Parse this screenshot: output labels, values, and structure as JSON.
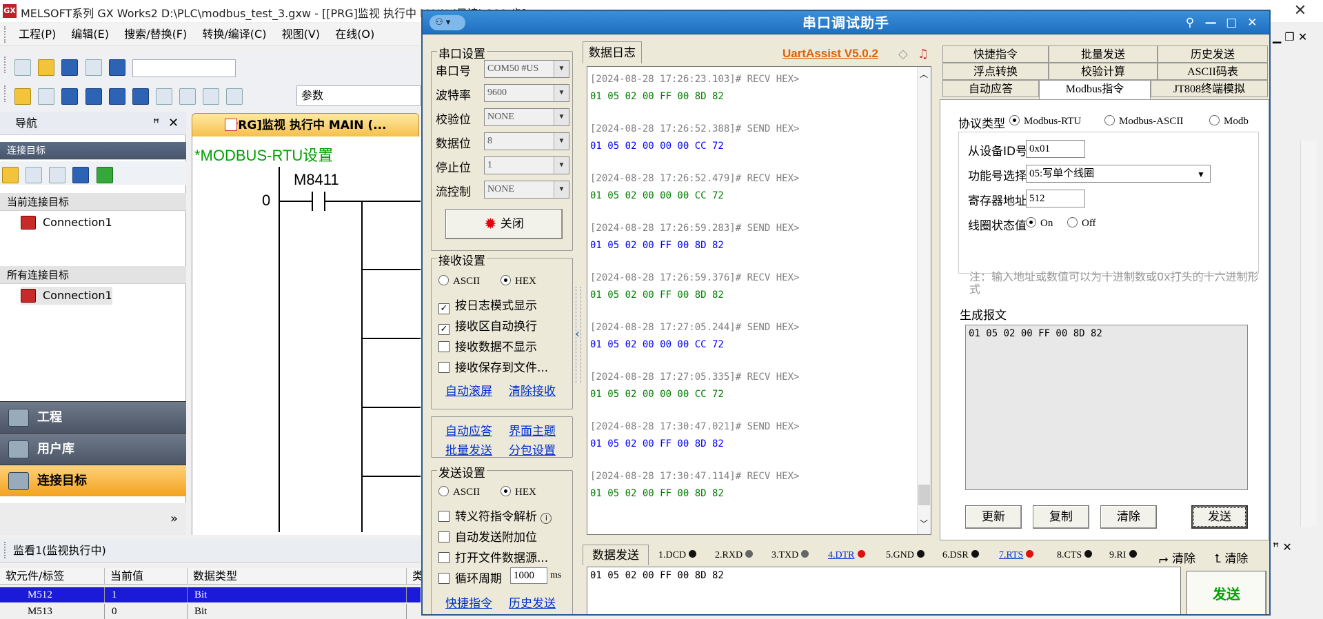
{
  "gx": {
    "title": "MELSOFT系列 GX Works2 D:\\PLC\\modbus_test_3.gxw - [[PRG]监视 执行中 MAIN (只读) 192 步]",
    "title_icon": "GX",
    "close_glyph": "✕",
    "menus": [
      "工程(P)",
      "编辑(E)",
      "搜索/替换(F)",
      "转换/编译(C)",
      "视图(V)",
      "在线(O)"
    ],
    "param_field": "参数",
    "nav": {
      "title": "导航",
      "pin": "ꟸ",
      "close": "✕",
      "target_header": "连接目标",
      "current_header": "当前连接目标",
      "current_item": "Connection1",
      "all_header": "所有连接目标",
      "all_item": "Connection1",
      "big_items": [
        "工程",
        "用户库",
        "连接目标"
      ],
      "expander": "»"
    },
    "ladder": {
      "tab_label": "[PRG]监视 执行中 MAIN (...",
      "title": "*MODBUS-RTU设置",
      "contact": "M8411",
      "step": "0"
    },
    "watch": {
      "title": "监看1(监视执行中)",
      "columns": [
        "软元件/标签",
        "当前值",
        "数据类型",
        "类"
      ],
      "rows": [
        {
          "device": "M512",
          "value": "1",
          "type": "Bit",
          "selected": true
        },
        {
          "device": "M513",
          "value": "0",
          "type": "Bit",
          "selected": false
        }
      ]
    },
    "right_ctrls": "▁ ❐ ✕",
    "right_bottom": "ꟸ ✕"
  },
  "ua": {
    "title": "串口调试助手",
    "sysmenu": "⚇ ▾",
    "title_buttons": [
      "⚲",
      "—",
      "□",
      "✕"
    ],
    "version": "UartAssist V5.0.2",
    "serial": {
      "group_label": "串口设置",
      "fields": [
        {
          "label": "串口号",
          "value": "COM50 #US"
        },
        {
          "label": "波特率",
          "value": "9600"
        },
        {
          "label": "校验位",
          "value": "NONE"
        },
        {
          "label": "数据位",
          "value": "8"
        },
        {
          "label": "停止位",
          "value": "1"
        },
        {
          "label": "流控制",
          "value": "NONE"
        }
      ],
      "close_button": "关闭"
    },
    "recv": {
      "group_label": "接收设置",
      "mode_ascii": "ASCII",
      "mode_hex": "HEX",
      "options": [
        {
          "label": "按日志模式显示",
          "checked": true
        },
        {
          "label": "接收区自动换行",
          "checked": true
        },
        {
          "label": "接收数据不显示",
          "checked": false
        },
        {
          "label": "接收保存到文件...",
          "checked": false
        }
      ],
      "link_scroll": "自动滚屏",
      "link_clear": "清除接收"
    },
    "misc_links": [
      "自动应答",
      "界面主题",
      "批量发送",
      "分包设置"
    ],
    "send": {
      "group_label": "发送设置",
      "mode_ascii": "ASCII",
      "mode_hex": "HEX",
      "options": [
        {
          "label": "转义符指令解析",
          "checked": false
        },
        {
          "label": "自动发送附加位",
          "checked": false
        },
        {
          "label": "打开文件数据源...",
          "checked": false
        },
        {
          "label": "循环周期",
          "checked": false
        }
      ],
      "cycle_value": "1000",
      "cycle_unit": "ms",
      "link_quick": "快捷指令",
      "link_history": "历史发送"
    },
    "log_tab": "数据日志",
    "log": [
      {
        "head": "[2024-08-28 17:26:23.103]# RECV HEX>",
        "data": "01 05 02 00 FF 00 8D 82",
        "dir": "recv"
      },
      {
        "head": "[2024-08-28 17:26:52.388]# SEND HEX>",
        "data": "01 05 02 00 00 00 CC 72",
        "dir": "send"
      },
      {
        "head": "[2024-08-28 17:26:52.479]# RECV HEX>",
        "data": "01 05 02 00 00 00 CC 72",
        "dir": "recv"
      },
      {
        "head": "[2024-08-28 17:26:59.283]# SEND HEX>",
        "data": "01 05 02 00 FF 00 8D 82",
        "dir": "send"
      },
      {
        "head": "[2024-08-28 17:26:59.376]# RECV HEX>",
        "data": "01 05 02 00 FF 00 8D 82",
        "dir": "recv"
      },
      {
        "head": "[2024-08-28 17:27:05.244]# SEND HEX>",
        "data": "01 05 02 00 00 00 CC 72",
        "dir": "send"
      },
      {
        "head": "[2024-08-28 17:27:05.335]# RECV HEX>",
        "data": "01 05 02 00 00 00 CC 72",
        "dir": "recv"
      },
      {
        "head": "[2024-08-28 17:30:47.021]# SEND HEX>",
        "data": "01 05 02 00 FF 00 8D 82",
        "dir": "send"
      },
      {
        "head": "[2024-08-28 17:30:47.114]# RECV HEX>",
        "data": "01 05 02 00 FF 00 8D 82",
        "dir": "recv"
      }
    ],
    "right_tabs_row1": [
      "快捷指令",
      "批量发送",
      "历史发送"
    ],
    "right_tabs_row2": [
      "浮点转换",
      "校验计算",
      "ASCII码表"
    ],
    "right_tabs_row3": [
      "自动应答",
      "Modbus指令",
      "JT808终端模拟"
    ],
    "modbus": {
      "protocol_label": "协议类型",
      "protocol_rtu": "Modbus-RTU",
      "protocol_ascii": "Modbus-ASCII",
      "protocol_tcp": "Modb",
      "slave_label": "从设备ID号",
      "slave_value": "0x01",
      "func_label": "功能号选择",
      "func_value": "05:写单个线圈",
      "reg_label": "寄存器地址",
      "reg_value": "512",
      "coil_label": "线圈状态值",
      "coil_on": "On",
      "coil_off": "Off",
      "note": "注：输入地址或数值可以为十进制数或0x打头的十六进制形式",
      "gen_label": "生成报文",
      "gen_value": "01 05 02 00 FF 00 8D 82",
      "buttons": [
        "更新",
        "复制",
        "清除",
        "发送"
      ]
    },
    "send_tab": "数据发送",
    "signals": [
      {
        "label": "1.DCD",
        "dot": "black",
        "link": false
      },
      {
        "label": "2.RXD",
        "dot": "gray",
        "link": false
      },
      {
        "label": "3.TXD",
        "dot": "gray",
        "link": false
      },
      {
        "label": "4.DTR",
        "dot": "red",
        "link": true
      },
      {
        "label": "5.GND",
        "dot": "black",
        "link": false
      },
      {
        "label": "6.DSR",
        "dot": "black",
        "link": false
      },
      {
        "label": "7.RTS",
        "dot": "red",
        "link": true
      },
      {
        "label": "8.CTS",
        "dot": "black",
        "link": false
      },
      {
        "label": "9.RI",
        "dot": "black",
        "link": false
      }
    ],
    "clear1": "清除",
    "clear2": "清除",
    "send_value": "01 05 02 00 FF 00 8D 82",
    "send_button": "发送"
  }
}
